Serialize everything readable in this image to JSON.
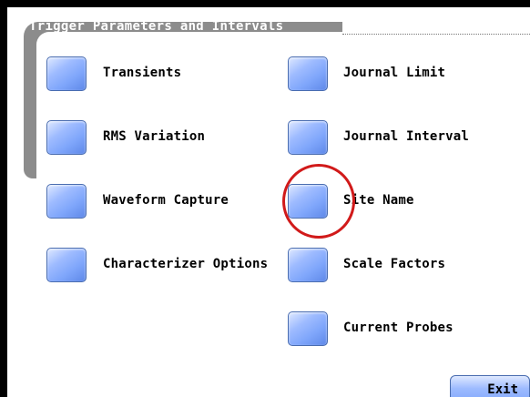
{
  "panel": {
    "title": "Trigger Parameters and Intervals"
  },
  "left_options": [
    {
      "label": "Transients"
    },
    {
      "label": "RMS Variation"
    },
    {
      "label": "Waveform Capture"
    },
    {
      "label": "Characterizer Options"
    }
  ],
  "right_options": [
    {
      "label": "Journal Limit"
    },
    {
      "label": "Journal Interval"
    },
    {
      "label": "Site Name"
    },
    {
      "label": "Scale Factors"
    },
    {
      "label": "Current Probes"
    }
  ],
  "exit": {
    "label": "Exit"
  },
  "highlight": {
    "target": "Site Name",
    "color": "#d11a1a"
  }
}
